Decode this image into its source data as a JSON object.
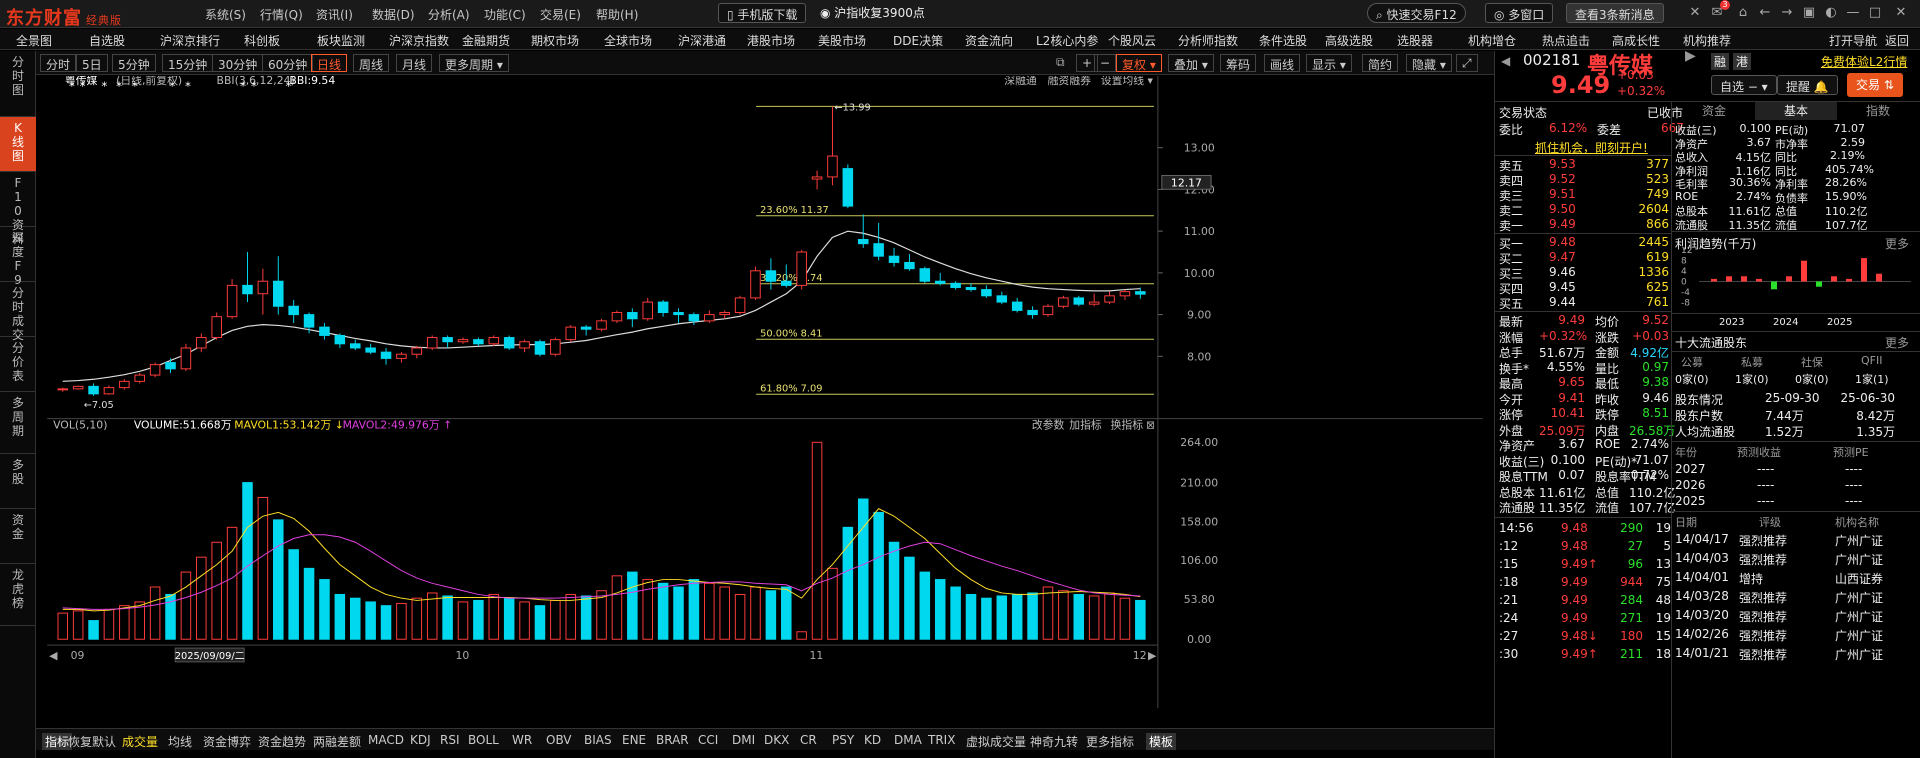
{
  "app": {
    "logo": "东方财富",
    "edition": "经典版"
  },
  "menu": [
    "系统(S)",
    "行情(Q)",
    "资讯(I)",
    "数据(D)",
    "分析(A)",
    "功能(C)",
    "交易(E)",
    "帮助(H)"
  ],
  "top": {
    "mobile": "手机版下载",
    "news": "沪指收复3900点",
    "quick_trade": "快速交易F12",
    "multi_window": "多窗口",
    "unread": "查看3条新消息",
    "msg_count": "3"
  },
  "nav": [
    "全景图",
    "自选股",
    "沪深京排行",
    "科创板",
    "板块监测",
    "沪深京指数",
    "金融期货",
    "期权市场",
    "全球市场",
    "沪深港通",
    "港股市场",
    "美股市场",
    "DDE决策",
    "资金流向",
    "L2核心内参",
    "个股风云",
    "分析师指数",
    "条件选股",
    "高级选股",
    "选股器",
    "机构增仓",
    "热点追击",
    "高成长性",
    "机构推荐",
    "打开导航",
    "返回"
  ],
  "left_tabs": [
    "分时图",
    "K线图",
    "F10资料",
    "深度F9",
    "分时成交",
    "分价表",
    "多周期",
    "多股",
    "资金",
    "龙虎榜"
  ],
  "period": [
    "分时",
    "5日",
    "5分钟",
    "15分钟",
    "30分钟",
    "60分钟",
    "日线",
    "周线",
    "月线",
    "更多周期"
  ],
  "toolbar": {
    "fq": "复权",
    "overlay": "叠加",
    "chips": "筹码",
    "draw": "画线",
    "display": "显示",
    "simplify": "简约",
    "hide": "隐藏"
  },
  "chart_head": {
    "name": "粤传媒",
    "mode": "(日线,前复权)",
    "bbi_label": "BBI(3,6,12,24)",
    "bbi_value": "BBI:9.54",
    "links": [
      "深融通",
      "融资融券",
      "设置均线"
    ]
  },
  "fib": [
    {
      "label": "23.60% 11.37"
    },
    {
      "label": "38.20% 9.74"
    },
    {
      "label": "50.00% 8.41"
    },
    {
      "label": "61.80% 7.09"
    }
  ],
  "high_label": "13.99",
  "low_label": "7.05",
  "price_tag": "12.17",
  "cur_date": "2025/09/09/二",
  "vol_head": {
    "label": "VOL(5,10)",
    "volume": "VOLUME:51.668万",
    "ma1": "MAVOL1:53.142万",
    "ma2": "MAVOL2:49.976万",
    "actions": [
      "改参数",
      "加指标",
      "换指标"
    ]
  },
  "chart_data": {
    "type": "candlestick",
    "title": "粤传媒",
    "ylim": [
      6.6,
      14.2
    ],
    "y_ticks": [
      "13.00",
      "12.00",
      "11.00",
      "10.00",
      "9.00",
      "8.00"
    ],
    "vol_ticks": [
      "264.00",
      "210.00",
      "158.00",
      "106.00",
      "53.80",
      "0.00"
    ],
    "x_labels": [
      "09",
      "10",
      "11",
      "12"
    ],
    "candles": [
      [
        7.2,
        7.25,
        7.15,
        7.22
      ],
      [
        7.22,
        7.3,
        7.2,
        7.28
      ],
      [
        7.28,
        7.35,
        7.05,
        7.1
      ],
      [
        7.1,
        7.3,
        7.08,
        7.25
      ],
      [
        7.25,
        7.45,
        7.2,
        7.4
      ],
      [
        7.4,
        7.6,
        7.35,
        7.55
      ],
      [
        7.55,
        7.85,
        7.5,
        7.8
      ],
      [
        7.85,
        7.95,
        7.6,
        7.7
      ],
      [
        7.7,
        8.3,
        7.65,
        8.2
      ],
      [
        8.2,
        8.55,
        8.1,
        8.45
      ],
      [
        8.45,
        9.05,
        8.4,
        8.95
      ],
      [
        8.95,
        9.85,
        8.9,
        9.7
      ],
      [
        9.7,
        10.5,
        9.3,
        9.5
      ],
      [
        9.5,
        10.1,
        9.0,
        9.8
      ],
      [
        9.8,
        10.4,
        9.0,
        9.2
      ],
      [
        9.2,
        9.35,
        8.8,
        9.0
      ],
      [
        9.0,
        9.05,
        8.55,
        8.7
      ],
      [
        8.7,
        8.8,
        8.4,
        8.5
      ],
      [
        8.5,
        8.55,
        8.2,
        8.3
      ],
      [
        8.3,
        8.4,
        8.15,
        8.2
      ],
      [
        8.2,
        8.3,
        8.05,
        8.1
      ],
      [
        8.1,
        8.2,
        7.8,
        7.95
      ],
      [
        7.95,
        8.1,
        7.85,
        8.05
      ],
      [
        8.05,
        8.25,
        7.95,
        8.2
      ],
      [
        8.2,
        8.5,
        8.15,
        8.45
      ],
      [
        8.45,
        8.5,
        8.2,
        8.35
      ],
      [
        8.35,
        8.45,
        8.3,
        8.4
      ],
      [
        8.4,
        8.45,
        8.25,
        8.3
      ],
      [
        8.3,
        8.5,
        8.25,
        8.45
      ],
      [
        8.45,
        8.5,
        8.15,
        8.2
      ],
      [
        8.2,
        8.4,
        8.1,
        8.35
      ],
      [
        8.35,
        8.4,
        8.0,
        8.05
      ],
      [
        8.05,
        8.45,
        8.0,
        8.4
      ],
      [
        8.4,
        8.75,
        8.35,
        8.7
      ],
      [
        8.7,
        8.75,
        8.5,
        8.65
      ],
      [
        8.65,
        8.9,
        8.6,
        8.85
      ],
      [
        8.85,
        9.1,
        8.8,
        9.05
      ],
      [
        9.05,
        9.15,
        8.7,
        8.9
      ],
      [
        8.9,
        9.4,
        8.85,
        9.3
      ],
      [
        9.3,
        9.35,
        8.95,
        9.05
      ],
      [
        9.05,
        9.15,
        8.8,
        9.0
      ],
      [
        9.0,
        9.05,
        8.75,
        8.85
      ],
      [
        8.85,
        9.1,
        8.8,
        9.0
      ],
      [
        9.0,
        9.1,
        8.9,
        9.05
      ],
      [
        9.05,
        9.45,
        9.0,
        9.4
      ],
      [
        9.4,
        10.15,
        9.35,
        10.05
      ],
      [
        10.05,
        10.35,
        9.6,
        9.8
      ],
      [
        9.8,
        10.2,
        9.65,
        9.7
      ],
      [
        9.7,
        10.55,
        9.6,
        10.5
      ],
      [
        12.25,
        12.45,
        12.0,
        12.3
      ],
      [
        12.3,
        13.99,
        12.1,
        12.8
      ],
      [
        12.5,
        12.6,
        11.55,
        11.6
      ],
      [
        10.8,
        11.4,
        10.6,
        10.7
      ],
      [
        10.7,
        11.2,
        10.3,
        10.4
      ],
      [
        10.4,
        10.6,
        10.15,
        10.25
      ],
      [
        10.25,
        10.45,
        10.05,
        10.1
      ],
      [
        10.1,
        10.15,
        9.75,
        9.8
      ],
      [
        9.8,
        10.0,
        9.7,
        9.75
      ],
      [
        9.75,
        9.8,
        9.6,
        9.65
      ],
      [
        9.65,
        9.75,
        9.55,
        9.6
      ],
      [
        9.6,
        9.7,
        9.4,
        9.45
      ],
      [
        9.45,
        9.55,
        9.25,
        9.3
      ],
      [
        9.3,
        9.4,
        9.05,
        9.1
      ],
      [
        9.1,
        9.2,
        8.9,
        9.0
      ],
      [
        9.0,
        9.25,
        8.95,
        9.2
      ],
      [
        9.2,
        9.45,
        9.15,
        9.4
      ],
      [
        9.4,
        9.45,
        9.2,
        9.25
      ],
      [
        9.25,
        9.5,
        9.2,
        9.3
      ],
      [
        9.3,
        9.55,
        9.25,
        9.45
      ],
      [
        9.45,
        9.6,
        9.35,
        9.55
      ],
      [
        9.55,
        9.65,
        9.38,
        9.49
      ]
    ],
    "ma": [
      7.4,
      7.42,
      7.45,
      7.5,
      7.56,
      7.64,
      7.75,
      7.9,
      8.05,
      8.25,
      8.45,
      8.62,
      8.72,
      8.76,
      8.74,
      8.7,
      8.64,
      8.57,
      8.5,
      8.43,
      8.37,
      8.3,
      8.25,
      8.22,
      8.2,
      8.2,
      8.22,
      8.24,
      8.26,
      8.27,
      8.28,
      8.28,
      8.3,
      8.34,
      8.38,
      8.45,
      8.52,
      8.58,
      8.66,
      8.72,
      8.78,
      8.82,
      8.86,
      8.9,
      8.96,
      9.1,
      9.3,
      9.5,
      9.8,
      10.4,
      10.85,
      11.0,
      10.95,
      10.85,
      10.72,
      10.55,
      10.38,
      10.24,
      10.1,
      9.98,
      9.88,
      9.8,
      9.72,
      9.66,
      9.62,
      9.6,
      9.58,
      9.57,
      9.57,
      9.6,
      9.62
    ],
    "volume": [
      35,
      38,
      25,
      40,
      45,
      50,
      70,
      60,
      90,
      110,
      130,
      150,
      210,
      190,
      160,
      120,
      95,
      80,
      60,
      55,
      50,
      45,
      48,
      55,
      62,
      58,
      50,
      52,
      60,
      55,
      50,
      45,
      52,
      60,
      58,
      65,
      85,
      90,
      80,
      75,
      70,
      80,
      75,
      70,
      60,
      70,
      65,
      70,
      10,
      264,
      95,
      150,
      188,
      170,
      130,
      110,
      90,
      80,
      70,
      60,
      55,
      58,
      60,
      62,
      70,
      65,
      60,
      58,
      62,
      55,
      52
    ],
    "vma1": [
      40,
      40,
      38,
      39,
      42,
      45,
      52,
      58,
      70,
      85,
      100,
      118,
      150,
      165,
      170,
      162,
      145,
      122,
      100,
      85,
      70,
      60,
      55,
      52,
      54,
      56,
      56,
      56,
      56,
      56,
      55,
      53,
      52,
      52,
      54,
      56,
      62,
      70,
      76,
      80,
      80,
      78,
      76,
      75,
      73,
      70,
      68,
      67,
      55,
      80,
      100,
      125,
      150,
      175,
      165,
      150,
      135,
      115,
      95,
      80,
      68,
      62,
      60,
      60,
      62,
      63,
      64,
      63,
      62,
      60,
      57
    ],
    "vma2": [
      42,
      41,
      40,
      40,
      41,
      43,
      46,
      50,
      56,
      63,
      72,
      82,
      98,
      112,
      125,
      135,
      140,
      140,
      137,
      130,
      118,
      105,
      92,
      82,
      75,
      70,
      65,
      60,
      57,
      55,
      55,
      55,
      55,
      56,
      57,
      58,
      60,
      63,
      67,
      70,
      73,
      75,
      76,
      77,
      77,
      75,
      74,
      73,
      65,
      75,
      82,
      92,
      100,
      110,
      118,
      125,
      130,
      128,
      120,
      112,
      105,
      98,
      92,
      85,
      78,
      72,
      66,
      62,
      60,
      59,
      58
    ],
    "stars": [
      [
        18
      ],
      [
        29
      ],
      [
        51
      ],
      [
        66
      ],
      [
        82
      ],
      [
        120
      ],
      [
        136
      ],
      [
        192
      ],
      [
        203
      ],
      [
        238
      ]
    ]
  },
  "quote": {
    "code": "002181",
    "name": "粤传媒",
    "tags": [
      "融",
      "港"
    ],
    "l2": "免费体验L2行情",
    "price": "9.49",
    "chg": "+0.03",
    "pct": "+0.32%",
    "watch": "自选",
    "remind": "提醒",
    "trade": "交易",
    "state_label": "交易状态",
    "state": "已收市",
    "wb_label": "委比",
    "wb": "6.12%",
    "wc_label": "委差",
    "wc": "667",
    "open_ad": "抓住机会，即刻开户!",
    "asks": [
      [
        "卖五",
        "9.53",
        "377"
      ],
      [
        "卖四",
        "9.52",
        "523"
      ],
      [
        "卖三",
        "9.51",
        "749"
      ],
      [
        "卖二",
        "9.50",
        "2604"
      ],
      [
        "卖一",
        "9.49",
        "866"
      ]
    ],
    "bids": [
      [
        "买一",
        "9.48",
        "2445"
      ],
      [
        "买二",
        "9.47",
        "619"
      ],
      [
        "买三",
        "9.46",
        "1336"
      ],
      [
        "买四",
        "9.45",
        "625"
      ],
      [
        "买五",
        "9.44",
        "761"
      ]
    ],
    "stats": [
      [
        "最新",
        "9.49",
        "均价",
        "9.52"
      ],
      [
        "涨幅",
        "+0.32%",
        "涨跌",
        "+0.03"
      ],
      [
        "总手",
        "51.67万",
        "金额",
        "4.92亿"
      ],
      [
        "换手*",
        "4.55%",
        "量比",
        "0.97"
      ],
      [
        "最高",
        "9.65",
        "最低",
        "9.38"
      ],
      [
        "今开",
        "9.41",
        "昨收",
        "9.46"
      ],
      [
        "涨停",
        "10.41",
        "跌停",
        "8.51"
      ],
      [
        "外盘",
        "25.09万",
        "内盘",
        "26.58万"
      ],
      [
        "净资产",
        "3.67",
        "ROE",
        "2.74%"
      ],
      [
        "收益(三)",
        "0.100",
        "PE(动)*",
        "71.07"
      ],
      [
        "股息TTM",
        "0.07",
        "股息率TTM",
        "0.72%"
      ],
      [
        "总股本",
        "11.61亿",
        "总值",
        "110.2亿"
      ],
      [
        "流通股",
        "11.35亿",
        "流值",
        "107.7亿"
      ]
    ],
    "ticks": [
      [
        "14:56",
        "9.48",
        "290",
        "19"
      ],
      [
        ":12",
        "9.48",
        "27",
        "5"
      ],
      [
        ":15",
        "9.49↑",
        "96",
        "13"
      ],
      [
        ":18",
        "9.49",
        "944",
        "75"
      ],
      [
        ":21",
        "9.49",
        "284",
        "48"
      ],
      [
        ":24",
        "9.49",
        "271",
        "19"
      ],
      [
        ":27",
        "9.48↓",
        "180",
        "15"
      ],
      [
        ":30",
        "9.49↑",
        "211",
        "18"
      ]
    ]
  },
  "fund": {
    "tabs": [
      "资金",
      "基本",
      "指数"
    ],
    "rows": [
      [
        "收益(三)",
        "0.100",
        "PE(动)",
        "71.07"
      ],
      [
        "净资产",
        "3.67",
        "市净率",
        "2.59"
      ],
      [
        "总收入",
        "4.15亿",
        "同比",
        "2.19%"
      ],
      [
        "净利润",
        "1.16亿",
        "同比",
        "405.74%"
      ],
      [
        "毛利率",
        "30.36%",
        "净利率",
        "28.26%"
      ],
      [
        "ROE",
        "2.74%",
        "负债率",
        "15.90%"
      ],
      [
        "总股本",
        "11.61亿",
        "总值",
        "110.2亿"
      ],
      [
        "流通股",
        "11.35亿",
        "流值",
        "107.7亿"
      ]
    ],
    "profit_title": "利润趋势(千万)",
    "more": "更多",
    "profit_y": [
      "12",
      "8",
      "4",
      "0",
      "-4",
      "-8"
    ],
    "profit_years": [
      "2023",
      "2024",
      "2025"
    ],
    "profit_bars": [
      1,
      2,
      2,
      1,
      -3,
      2,
      8,
      -2,
      2,
      1,
      9,
      3
    ],
    "holders_title": "十大流通股东",
    "holders_head": [
      "公募",
      "私募",
      "社保",
      "QFII"
    ],
    "holders_vals": [
      "0家(0)",
      "1家(0)",
      "0家(0)",
      "1家(1)"
    ],
    "holders_rows": [
      [
        "股东情况",
        "25-09-30",
        "25-06-30"
      ],
      [
        "股东户数",
        "7.44万",
        "8.42万"
      ],
      [
        "人均流通股",
        "1.52万",
        "1.35万"
      ]
    ],
    "fc_head": [
      "年份",
      "预测收益",
      "预测PE"
    ],
    "fc_rows": [
      [
        "2027",
        "----",
        "----"
      ],
      [
        "2026",
        "----",
        "----"
      ],
      [
        "2025",
        "----",
        "----"
      ]
    ],
    "rate_head": [
      "日期",
      "评级",
      "机构名称"
    ],
    "rate_rows": [
      [
        "14/04/17",
        "强烈推荐",
        "广州广证"
      ],
      [
        "14/04/03",
        "强烈推荐",
        "广州广证"
      ],
      [
        "14/04/01",
        "增持",
        "山西证券"
      ],
      [
        "14/03/28",
        "强烈推荐",
        "广州广证"
      ],
      [
        "14/03/20",
        "强烈推荐",
        "广州广证"
      ],
      [
        "14/02/26",
        "强烈推荐",
        "广州广证"
      ],
      [
        "14/01/21",
        "强烈推荐",
        "广州广证"
      ]
    ]
  },
  "bottom_tabs": [
    "指标",
    "恢复默认",
    "成交量",
    "均线",
    "资金博弈",
    "资金趋势",
    "两融差额",
    "MACD",
    "KDJ",
    "RSI",
    "BOLL",
    "WR",
    "OBV",
    "BIAS",
    "ENE",
    "BRAR",
    "CCI",
    "DMI",
    "DKX",
    "CR",
    "PSY",
    "KD",
    "DMA",
    "TRIX",
    "虚拟成交量",
    "神奇九转",
    "更多指标",
    "模板"
  ]
}
